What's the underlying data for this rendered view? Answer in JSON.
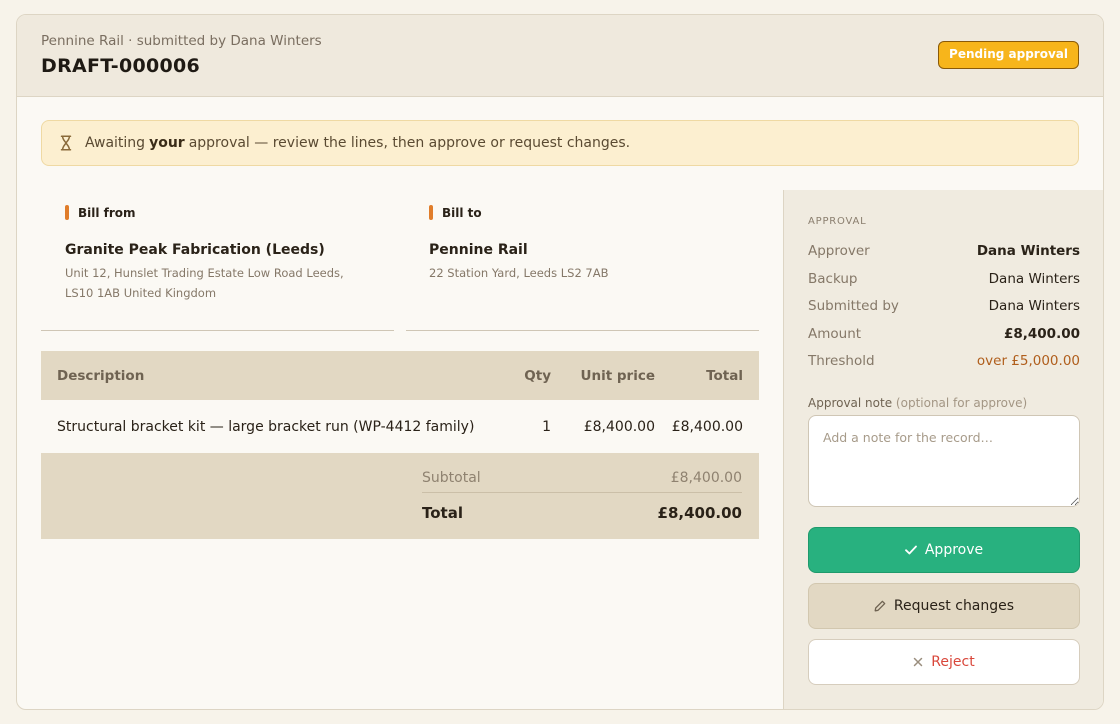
{
  "header": {
    "subtitle": "Pennine Rail · submitted by Dana Winters",
    "title": "DRAFT-000006",
    "status": "Pending approval"
  },
  "notice": {
    "icon": "hourglass-icon",
    "text_before": "Awaiting",
    "text_bold": "your",
    "text_after": "approval — review the lines, then approve or request changes."
  },
  "bill_from": {
    "label": "Bill from",
    "name": "Granite Peak Fabrication (Leeds)",
    "address_line1": "Unit 12, Hunslet Trading Estate Low Road Leeds,",
    "address_line2": "LS10 1AB United Kingdom"
  },
  "bill_to": {
    "label": "Bill to",
    "name": "Pennine Rail",
    "address_line1": "22 Station Yard, Leeds LS2 7AB"
  },
  "lines": {
    "headers": {
      "description": "Description",
      "qty": "Qty",
      "unit_price": "Unit price",
      "total": "Total"
    },
    "rows": [
      {
        "description": "Structural bracket kit — large bracket run (WP-4412 family)",
        "qty": "1",
        "unit_price": "£8,400.00",
        "total": "£8,400.00"
      }
    ],
    "subtotal_label": "Subtotal",
    "subtotal": "£8,400.00",
    "total_label": "Total",
    "total": "£8,400.00"
  },
  "approval": {
    "section_title": "APPROVAL",
    "approver_label": "Approver",
    "approver": "Dana Winters",
    "backup_label": "Backup",
    "backup": "Dana Winters",
    "submitted_by_label": "Submitted by",
    "submitted_by": "Dana Winters",
    "amount_label": "Amount",
    "amount": "£8,400.00",
    "threshold_label": "Threshold",
    "threshold": "over £5,000.00",
    "note_label": "Approval note",
    "note_hint": "(optional for approve)",
    "note_placeholder": "Add a note for the record…",
    "note_value": "",
    "approve_label": "Approve",
    "changes_label": "Request changes",
    "reject_label": "Reject"
  },
  "colors": {
    "accent_orange": "#e07d2a",
    "status_amber": "#f7b51b",
    "approve_green": "#28b17f",
    "reject_red": "#d9473b"
  }
}
